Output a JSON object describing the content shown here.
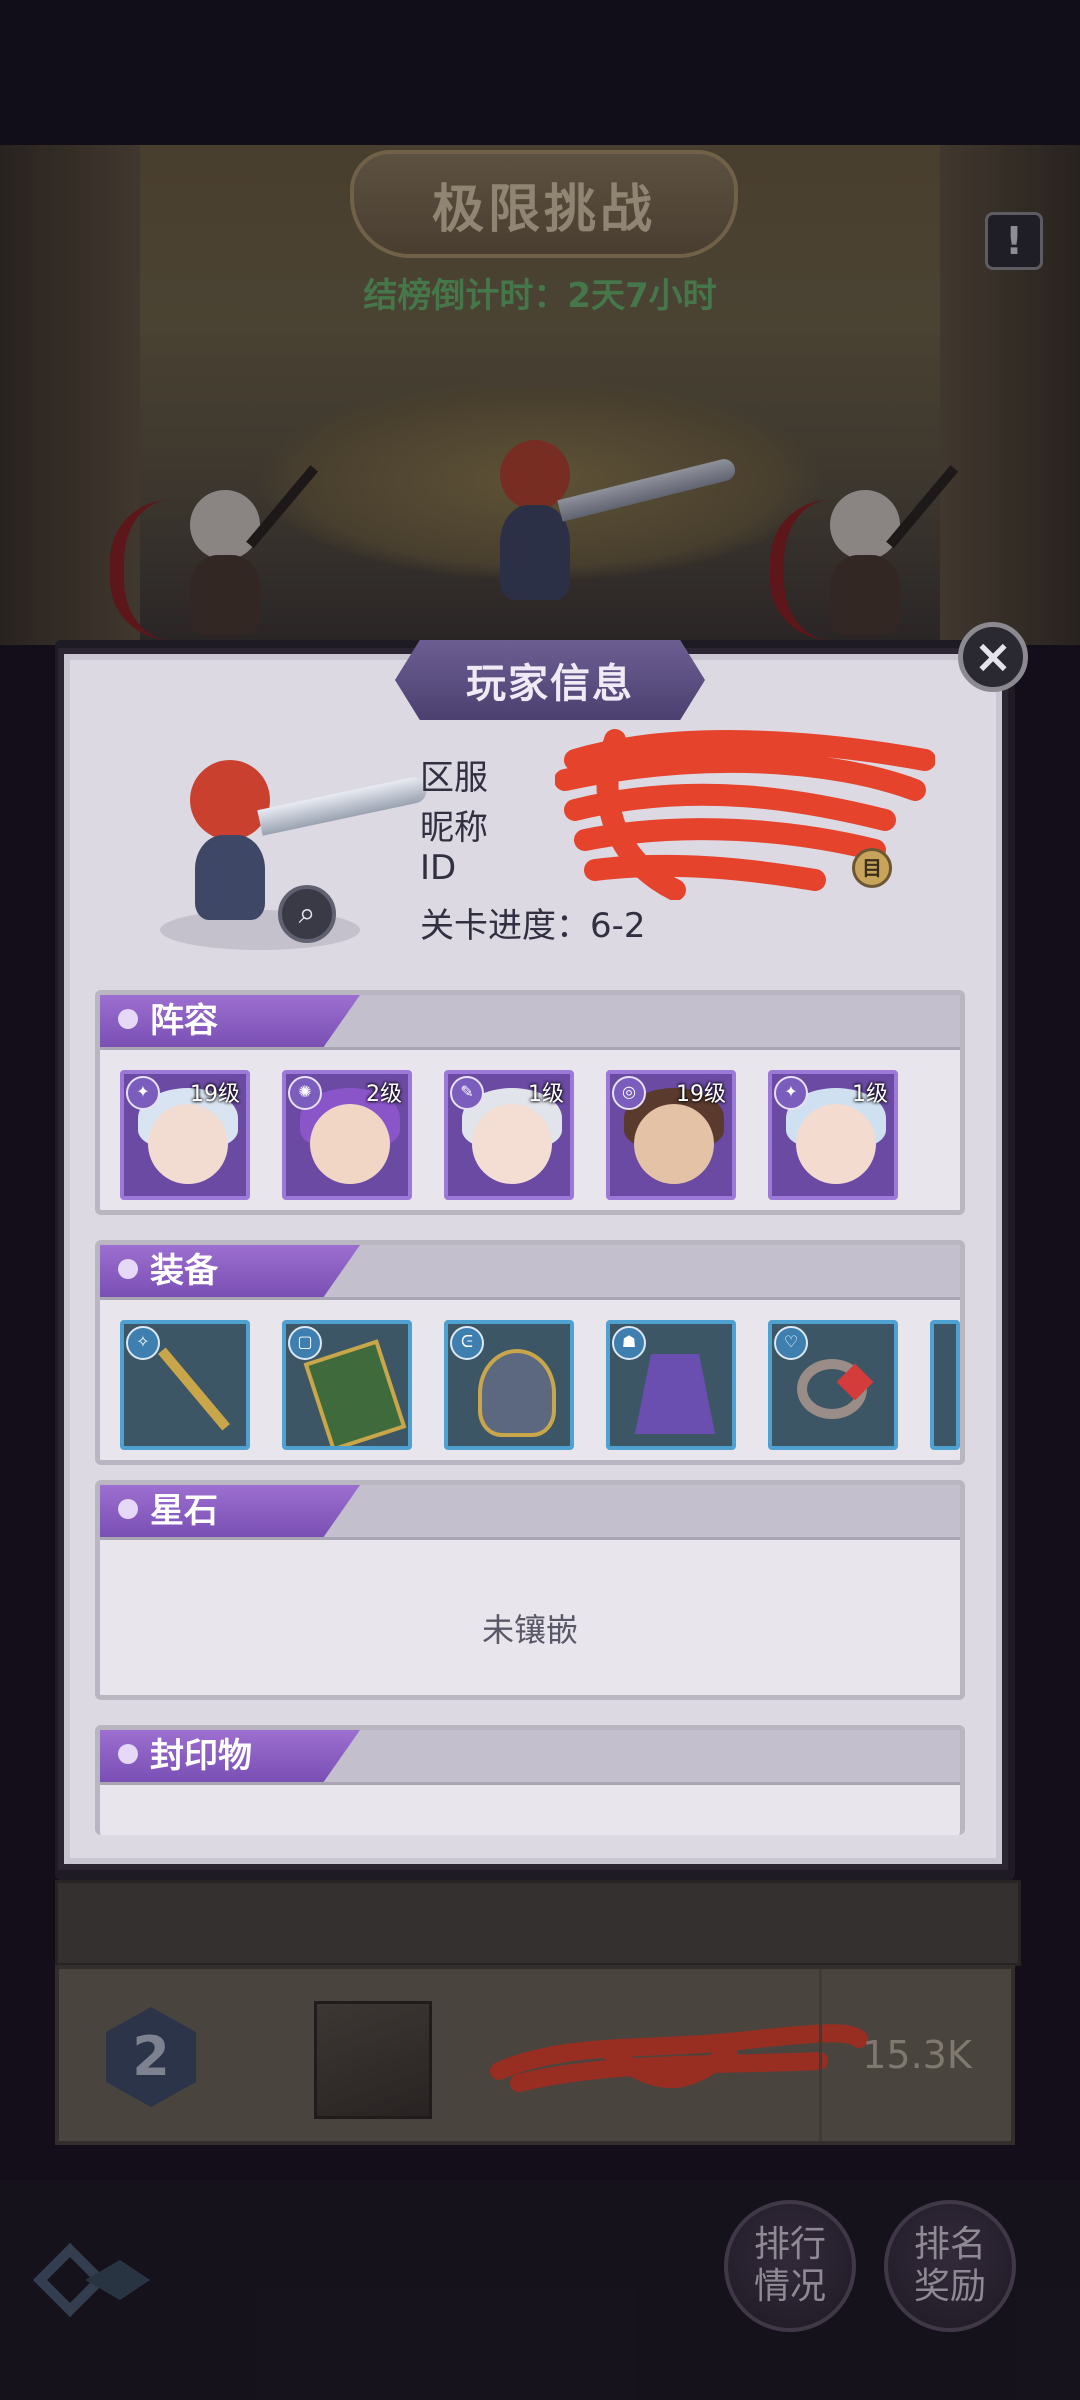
{
  "background": {
    "title": "极限挑战",
    "countdown": "结榜倒计时：2天7小时",
    "info_icon": "!"
  },
  "dialog": {
    "title": "玩家信息",
    "close_icon": "×",
    "player": {
      "server_label": "区服",
      "nickname_label": "昵称",
      "id_label": "ID",
      "progress_label": "关卡进度：6-2",
      "magnify_icon": "⌕",
      "copy_icon": "目"
    },
    "sections": {
      "lineup": {
        "title": "阵容",
        "heroes": [
          {
            "level": "19级",
            "class_icon": "✦"
          },
          {
            "level": "2级",
            "class_icon": "✺"
          },
          {
            "level": "1级",
            "class_icon": "✎"
          },
          {
            "level": "19级",
            "class_icon": "◎"
          },
          {
            "level": "1级",
            "class_icon": "✦"
          }
        ]
      },
      "equipment": {
        "title": "装备",
        "items": [
          {
            "name": "staff",
            "class_icon": "✧"
          },
          {
            "name": "book",
            "class_icon": "▢"
          },
          {
            "name": "helmet",
            "class_icon": "ᕮ"
          },
          {
            "name": "cloak",
            "class_icon": "☗"
          },
          {
            "name": "ring",
            "class_icon": "♡"
          }
        ]
      },
      "starstone": {
        "title": "星石",
        "empty_text": "未镶嵌"
      },
      "seal": {
        "title": "封印物"
      }
    }
  },
  "ranking": {
    "rank": "2",
    "score": "15.3K"
  },
  "bottom_nav": {
    "ranking_btn": [
      "排行",
      "情况"
    ],
    "reward_btn": [
      "排名",
      "奖励"
    ]
  },
  "colors": {
    "accent_purple": "#8a5ec6",
    "equip_blue": "#4ea1d0",
    "countdown_green": "#66b46a",
    "redaction": "#e5432c"
  }
}
